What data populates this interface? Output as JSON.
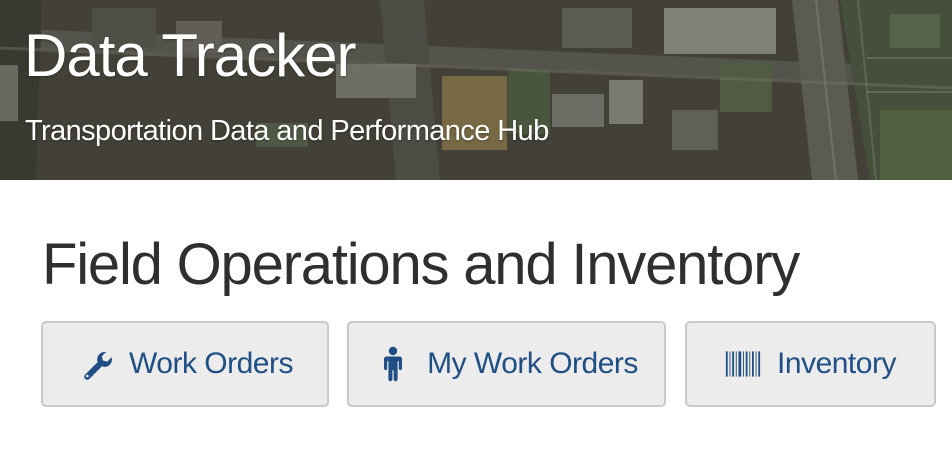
{
  "header": {
    "title": "Data Tracker",
    "subtitle": "Transportation Data and Performance Hub"
  },
  "main": {
    "section_title": "Field Operations and Inventory",
    "buttons": [
      {
        "label": "Work Orders",
        "icon": "wrench-icon"
      },
      {
        "label": "My Work Orders",
        "icon": "person-icon"
      },
      {
        "label": "Inventory",
        "icon": "barcode-icon"
      }
    ]
  },
  "colors": {
    "button_text": "#204f86",
    "button_bg": "#ececec",
    "button_border": "#c9c9c9",
    "heading_text": "#2f2f2f"
  }
}
